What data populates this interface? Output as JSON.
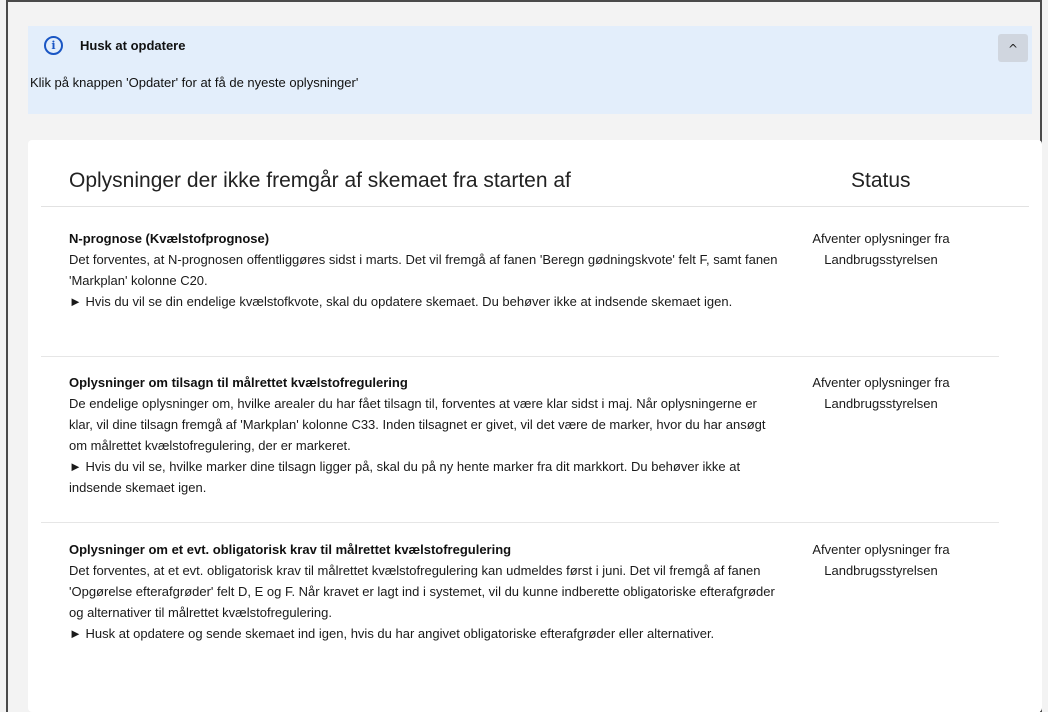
{
  "banner": {
    "icon": "info-icon",
    "title": "Husk at opdatere",
    "text": "Klik på knappen 'Opdater' for at få de nyeste oplysninger'",
    "collapse_icon": "chevron-up-icon",
    "collapse_glyph": "^"
  },
  "table": {
    "header_title": "Oplysninger der ikke fremgår af skemaet fra starten af",
    "header_status": "Status",
    "rows": [
      {
        "title": "N-prognose (Kvælstofprognose)",
        "description": "Det forventes, at N-prognosen offentliggøres sidst i marts. Det vil fremgå af fanen 'Beregn gødningskvote' felt F, samt fanen 'Markplan' kolonne C20.",
        "hint": "► Hvis du vil se din endelige kvælstofkvote, skal du opdatere skemaet. Du behøver ikke at indsende skemaet igen.",
        "status": "Afventer oplysninger fra Landbrugsstyrelsen"
      },
      {
        "title": "Oplysninger om tilsagn til målrettet kvælstofregulering",
        "description": "De endelige oplysninger om, hvilke arealer du har fået tilsagn til, forventes at være klar sidst i maj. Når oplysningerne er klar, vil dine tilsagn fremgå af 'Markplan' kolonne C33. Inden tilsagnet er givet, vil det være de marker, hvor du har ansøgt om målrettet kvælstofregulering, der er markeret.",
        "hint": "► Hvis du vil se, hvilke marker dine tilsagn ligger på, skal du på ny hente marker fra dit markkort. Du behøver ikke at indsende skemaet igen.",
        "status": "Afventer oplysninger fra Landbrugsstyrelsen"
      },
      {
        "title": "Oplysninger om et evt. obligatorisk krav til målrettet kvælstofregulering",
        "description": "Det forventes, at et evt. obligatorisk krav til målrettet kvælstofregulering kan udmeldes først i juni. Det vil fremgå af fanen 'Opgørelse efterafgrøder' felt D, E og F. Når kravet er lagt ind i systemet, vil du kunne indberette obligatoriske efterafgrøder og alternativer til målrettet kvælstofregulering.",
        "hint": "► Husk at opdatere og sende skemaet ind igen, hvis du har angivet obligatoriske efterafgrøder eller alternativer.",
        "status": "Afventer oplysninger fra Landbrugsstyrelsen"
      }
    ]
  }
}
